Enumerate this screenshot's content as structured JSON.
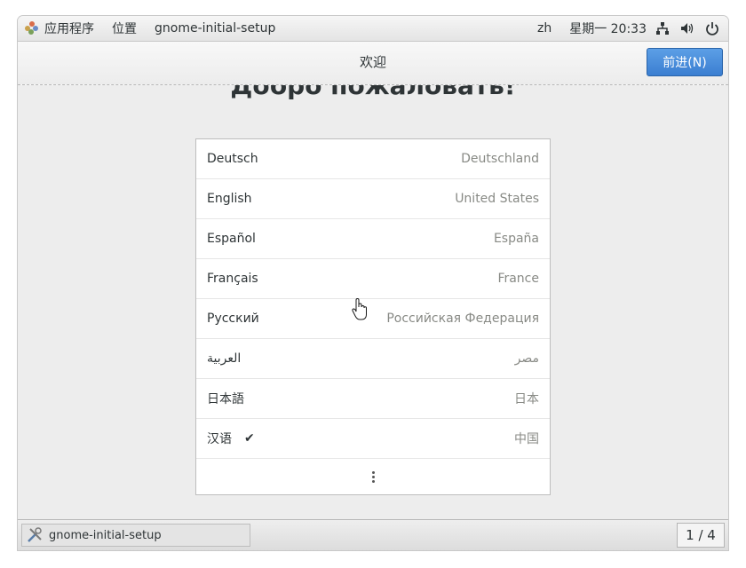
{
  "top_panel": {
    "applications": "应用程序",
    "places": "位置",
    "app_name": "gnome-initial-setup",
    "input_method": "zh",
    "clock": "星期一 20:33"
  },
  "header": {
    "title": "欢迎",
    "next_label": "前进(N)"
  },
  "welcome_title": "Добро пожаловать!",
  "languages": [
    {
      "name": "Deutsch",
      "region": "Deutschland",
      "selected": false
    },
    {
      "name": "English",
      "region": "United States",
      "selected": false
    },
    {
      "name": "Español",
      "region": "España",
      "selected": false
    },
    {
      "name": "Français",
      "region": "France",
      "selected": false
    },
    {
      "name": "Русский",
      "region": "Российская Федерация",
      "selected": false
    },
    {
      "name": "العربية",
      "region": "مصر",
      "selected": false
    },
    {
      "name": "日本語",
      "region": "日本",
      "selected": false
    },
    {
      "name": "汉语",
      "region": "中国",
      "selected": true
    }
  ],
  "taskbar": {
    "task_label": "gnome-initial-setup",
    "workspace": "1 / 4"
  },
  "colors": {
    "accent": "#3b7ed1",
    "panel_bg": "#ececec",
    "list_bg": "#ffffff"
  },
  "icons": {
    "apps": "gnome-foot-icon",
    "network": "network-wired-icon",
    "volume": "volume-icon",
    "power": "power-icon",
    "check": "check-icon",
    "more": "more-vertical-icon",
    "task": "tools-icon"
  }
}
